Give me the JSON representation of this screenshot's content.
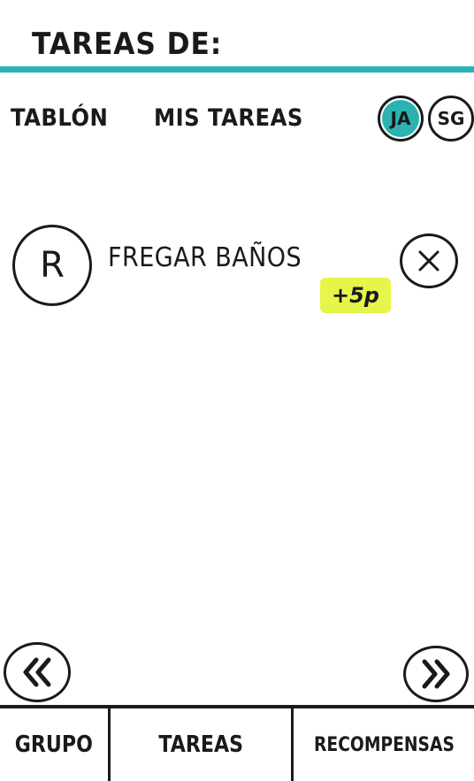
{
  "header": {
    "title": "TAREAS DE:"
  },
  "colors": {
    "accent": "#2bb3b1",
    "highlight": "#e6f54a",
    "ink": "#1a1a1a"
  },
  "nav": {
    "tabs": [
      {
        "label": "TABLÓN"
      },
      {
        "label": "MIS TAREAS"
      }
    ],
    "users": [
      {
        "initials": "JA",
        "selected": true
      },
      {
        "initials": "SG",
        "selected": false
      }
    ]
  },
  "task": {
    "left_button": "R",
    "name": "FREGAR BAÑOS",
    "points": "+5p",
    "remove_icon": "close-icon"
  },
  "pager": {
    "prev_icon": "double-chevron-left-icon",
    "next_icon": "double-chevron-right-icon"
  },
  "bottom_nav": {
    "items": [
      {
        "label": "GRUPO"
      },
      {
        "label": "TAREAS"
      },
      {
        "label": "RECOMPENSAS"
      }
    ]
  }
}
